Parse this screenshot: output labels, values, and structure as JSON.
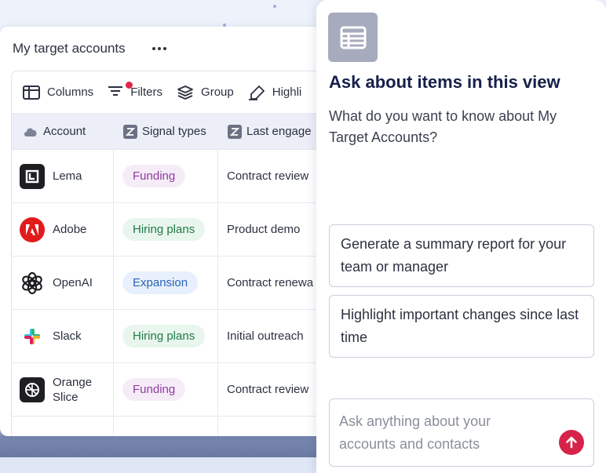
{
  "table": {
    "title": "My target accounts",
    "toolbar": {
      "columns": "Columns",
      "filters": "Filters",
      "group": "Group",
      "highlight": "Highli"
    },
    "headers": {
      "account": "Account",
      "signal_types": "Signal types",
      "last_engagement": "Last engage"
    },
    "rows": [
      {
        "name": "Lema",
        "name2": "",
        "signal": "Funding",
        "last": "Contract review"
      },
      {
        "name": "Adobe",
        "name2": "",
        "signal": "Hiring plans",
        "last": "Product demo"
      },
      {
        "name": "OpenAI",
        "name2": "",
        "signal": "Expansion",
        "last": "Contract renewa"
      },
      {
        "name": "Slack",
        "name2": "",
        "signal": "Hiring plans",
        "last": "Initial outreach"
      },
      {
        "name": "Orange",
        "name2": "Slice",
        "signal": "Funding",
        "last": "Contract review"
      }
    ]
  },
  "ask": {
    "title": "Ask about items in this view",
    "subtitle": "What do you want to know about My Target Accounts?",
    "suggestions": [
      "Generate a summary report for your team or manager",
      "Highlight important changes since last time"
    ],
    "input_placeholder": "Ask anything about your accounts and contacts"
  },
  "colors": {
    "accent": "#d7224a",
    "funding_pill": "#f6ecf8",
    "hiring_pill": "#e9f6ee",
    "expansion_pill": "#e7f0fc"
  }
}
